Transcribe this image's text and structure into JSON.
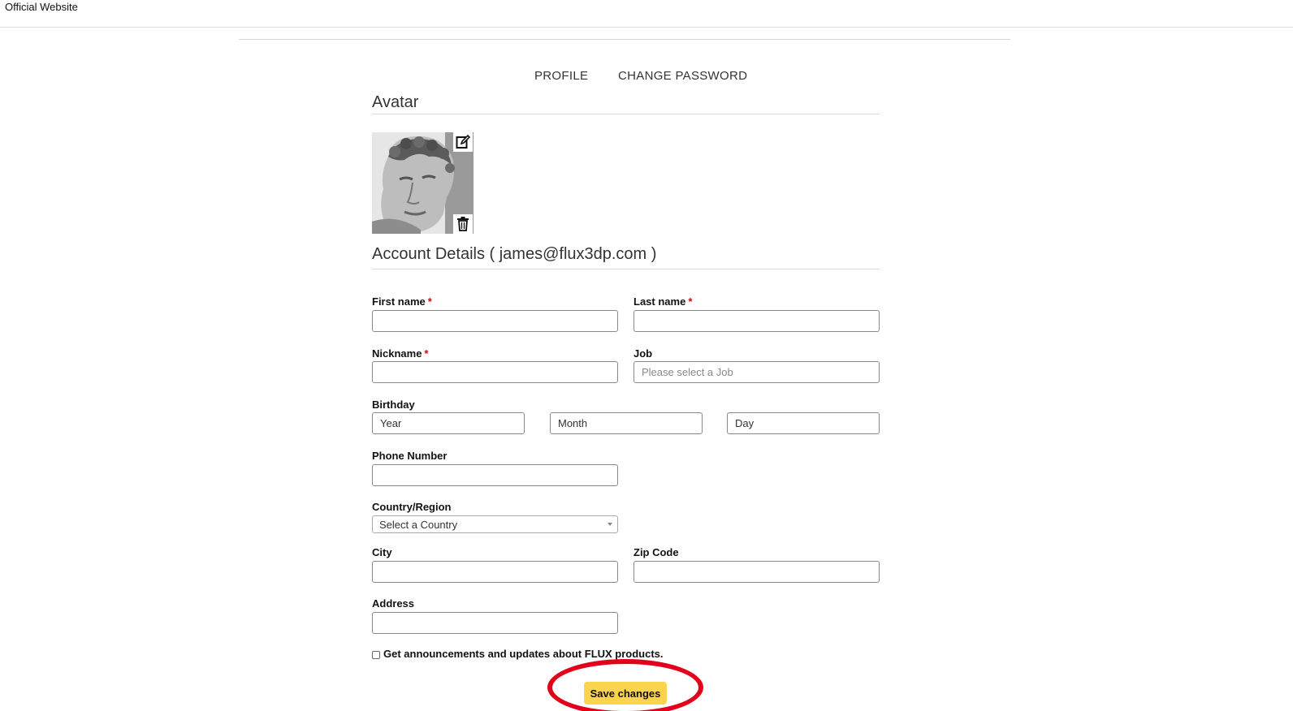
{
  "header": {
    "site_link": "Official Website"
  },
  "tabs": [
    {
      "label": "PROFILE"
    },
    {
      "label": "CHANGE PASSWORD"
    }
  ],
  "avatar": {
    "section_title": "Avatar",
    "edit_icon": "edit-icon",
    "delete_icon": "trash-icon"
  },
  "account": {
    "section_title": "Account Details ( james@flux3dp.com )"
  },
  "form": {
    "required_mark": "*",
    "first_name": {
      "label": "First name",
      "value": ""
    },
    "last_name": {
      "label": "Last name",
      "value": ""
    },
    "nickname": {
      "label": "Nickname",
      "value": ""
    },
    "job": {
      "label": "Job",
      "placeholder": "Please select a Job"
    },
    "birthday": {
      "label": "Birthday",
      "year": "Year",
      "month": "Month",
      "day": "Day"
    },
    "phone": {
      "label": "Phone Number",
      "value": ""
    },
    "country": {
      "label": "Country/Region",
      "selected": "Select a Country"
    },
    "city": {
      "label": "City",
      "value": ""
    },
    "zip": {
      "label": "Zip Code",
      "value": ""
    },
    "address": {
      "label": "Address",
      "value": ""
    },
    "newsletter": {
      "label": "Get announcements and updates about FLUX products.",
      "checked": false
    },
    "save_label": "Save changes"
  },
  "colors": {
    "save_button": "#fcd34d",
    "required": "#d0021b",
    "annotation": "#e3001b"
  }
}
